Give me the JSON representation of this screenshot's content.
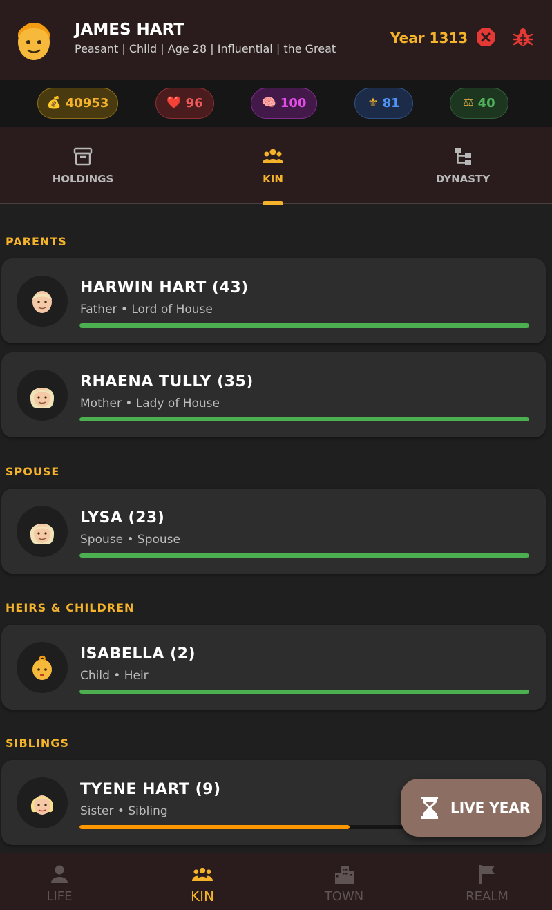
{
  "header": {
    "name": "JAMES HART",
    "subtitle": "Peasant | Child | Age 28 | Influential | the Great",
    "year": "Year 1313",
    "icons": [
      "person-face-icon",
      "close-octagon-icon",
      "bug-icon"
    ]
  },
  "stats": {
    "gold": {
      "icon": "money-bag-icon",
      "value": "40953",
      "color": "#f4b32b"
    },
    "health": {
      "icon": "heart-icon",
      "value": "96",
      "color": "#f25a5a"
    },
    "mind": {
      "icon": "brain-icon",
      "value": "100",
      "color": "#e24de8"
    },
    "faith": {
      "icon": "fleur-de-lis-icon",
      "value": "81",
      "color": "#4f93f5"
    },
    "justice": {
      "icon": "scales-icon",
      "value": "40",
      "color": "#4fb15a"
    }
  },
  "tabs": [
    {
      "label": "HOLDINGS",
      "icon": "archive-box-icon",
      "active": false
    },
    {
      "label": "KIN",
      "icon": "people-group-icon",
      "active": true
    },
    {
      "label": "DYNASTY",
      "icon": "family-tree-icon",
      "active": false
    }
  ],
  "sections": {
    "parents": "PARENTS",
    "spouse": "SPOUSE",
    "heirs": "HEIRS & CHILDREN",
    "siblings": "SIBLINGS"
  },
  "kin": {
    "harwin": {
      "name": "HARWIN HART (43)",
      "role": "Father • Lord of House",
      "relation": 1.0,
      "bar_color": "#4caf50",
      "portrait": "old-man-icon"
    },
    "rhaena": {
      "name": "RHAENA TULLY (35)",
      "role": "Mother • Lady of House",
      "relation": 1.0,
      "bar_color": "#4caf50",
      "portrait": "old-woman-icon"
    },
    "lysa": {
      "name": "LYSA (23)",
      "role": "Spouse • Spouse",
      "relation": 1.0,
      "bar_color": "#4caf50",
      "portrait": "old-woman-icon"
    },
    "isabella": {
      "name": "ISABELLA (2)",
      "role": "Child • Heir",
      "relation": 1.0,
      "bar_color": "#4caf50",
      "portrait": "baby-icon"
    },
    "tyene": {
      "name": "TYENE HART (9)",
      "role": "Sister • Sibling",
      "relation": 0.6,
      "bar_color": "#ff9800",
      "portrait": "girl-icon"
    }
  },
  "fab": {
    "label": "LIVE YEAR",
    "icon": "hourglass-icon"
  },
  "bottom_nav": [
    {
      "label": "LIFE",
      "icon": "person-icon",
      "active": false
    },
    {
      "label": "KIN",
      "icon": "people-group-icon",
      "active": true
    },
    {
      "label": "TOWN",
      "icon": "city-building-icon",
      "active": false
    },
    {
      "label": "REALM",
      "icon": "flag-icon",
      "active": false
    }
  ]
}
